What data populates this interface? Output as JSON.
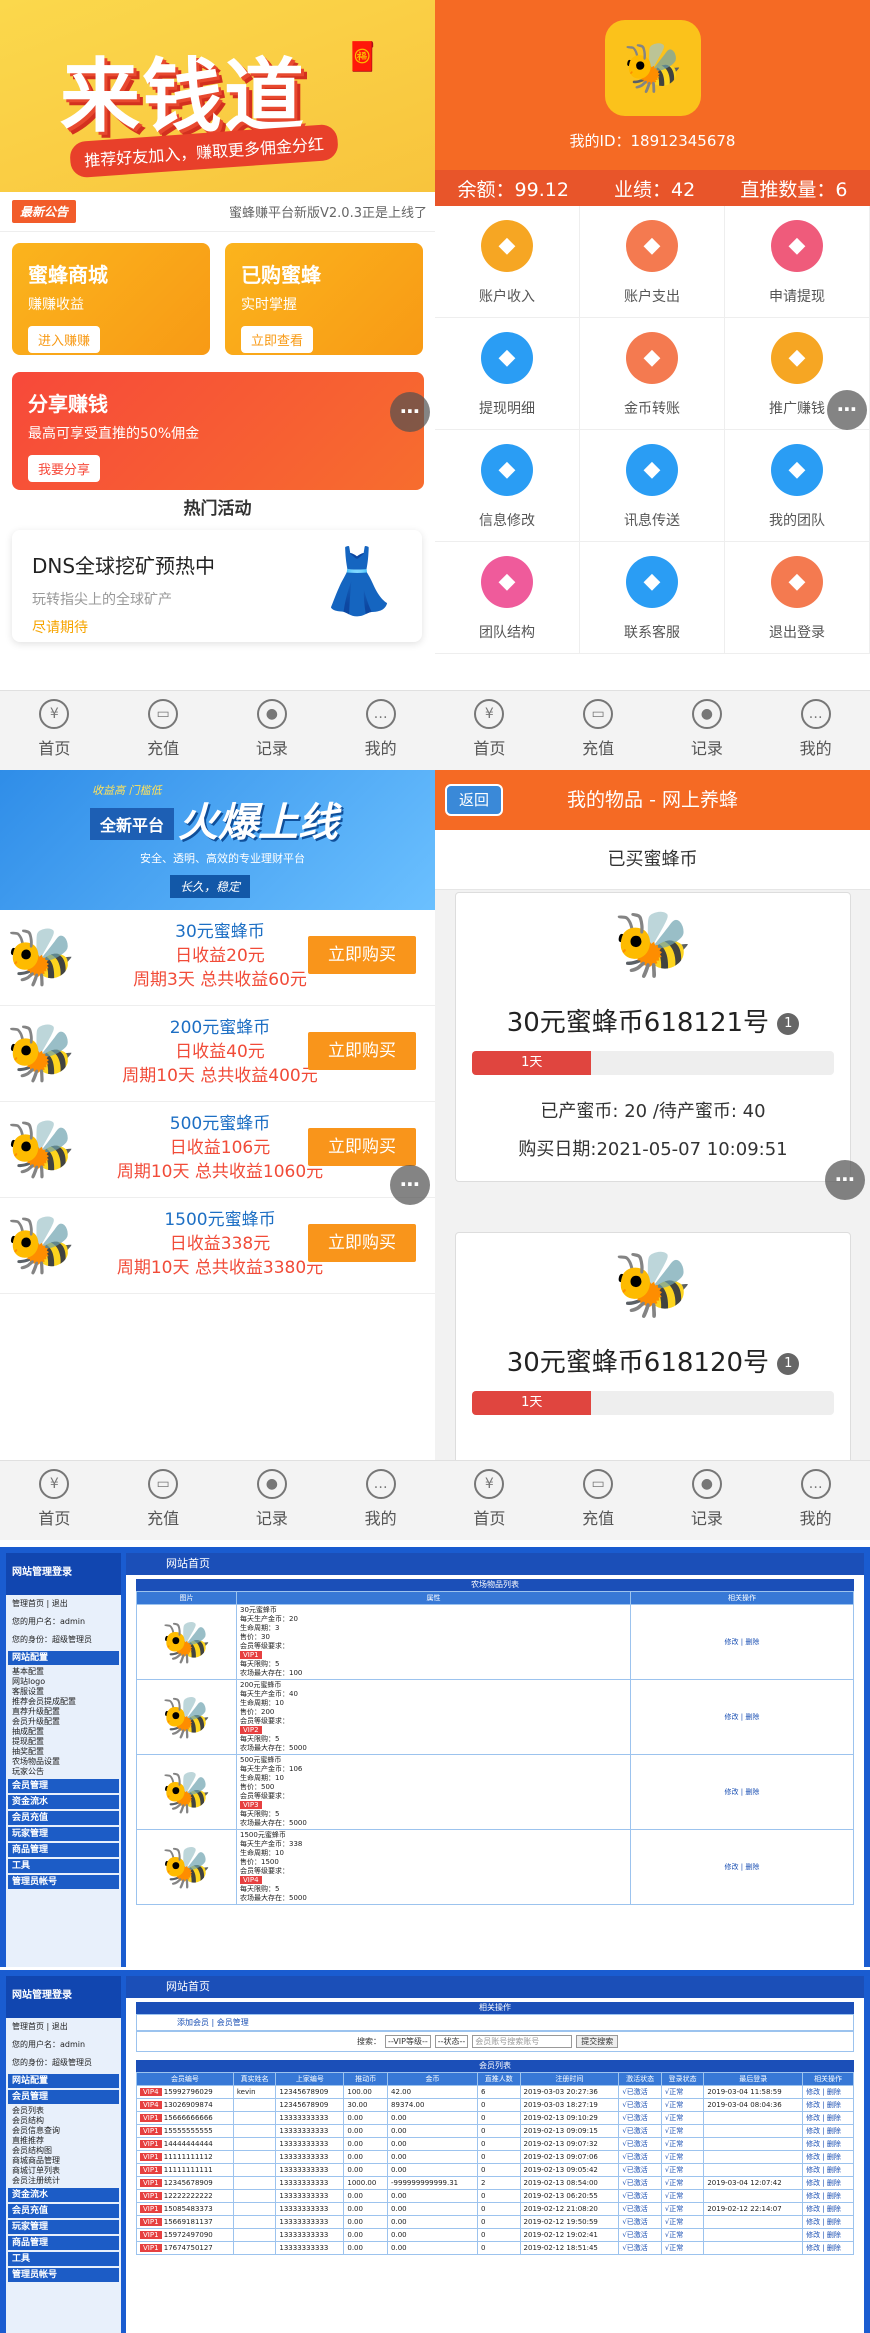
{
  "p1": {
    "title": "来钱道",
    "slogan": "推荐好友加入，赚取更多佣金分红",
    "notice_tag": "最新公告",
    "notice_text": "蜜蜂赚平台新版V2.0.3正是上线了",
    "cards": [
      {
        "title": "蜜蜂商城",
        "sub": "赚赚收益",
        "btn": "进入赚赚"
      },
      {
        "title": "已购蜜蜂",
        "sub": "实时掌握",
        "btn": "立即查看"
      },
      {
        "title": "分享赚钱",
        "sub": "最高可享受直推的50%佣金",
        "btn": "我要分享"
      }
    ],
    "hot": "热门活动",
    "dns_title": "DNS全球挖矿预热中",
    "dns_sub": "玩转指尖上的全球矿产",
    "dns_soon": "尽请期待"
  },
  "tabs": [
    {
      "label": "首页",
      "icon": "money-bag-icon"
    },
    {
      "label": "充值",
      "icon": "ticket-icon"
    },
    {
      "label": "记录",
      "icon": "location-icon"
    },
    {
      "label": "我的",
      "icon": "chat-icon"
    }
  ],
  "p2": {
    "myid": "我的ID：18912345678",
    "balance": "余额：99.12",
    "perf": "业绩：42",
    "direct": "直推数量：6",
    "grid": [
      {
        "label": "账户收入",
        "color": "#f6a623"
      },
      {
        "label": "账户支出",
        "color": "#f47a50"
      },
      {
        "label": "申请提现",
        "color": "#ef5b7b"
      },
      {
        "label": "提现明细",
        "color": "#2a9df4"
      },
      {
        "label": "金币转账",
        "color": "#f47a50"
      },
      {
        "label": "推广赚钱",
        "color": "#f6a623"
      },
      {
        "label": "信息修改",
        "color": "#2a9df4"
      },
      {
        "label": "讯息传送",
        "color": "#2a9df4"
      },
      {
        "label": "我的团队",
        "color": "#2a9df4"
      },
      {
        "label": "团队结构",
        "color": "#ef5b9b"
      },
      {
        "label": "联系客服",
        "color": "#2a9df4"
      },
      {
        "label": "退出登录",
        "color": "#f47a50"
      }
    ]
  },
  "p3": {
    "ban_tag": "全新平台",
    "ban_head": "火爆上线",
    "ban_pre": "收益高 门槛低",
    "ban_sub": "安全、透明、高效的专业理财平台",
    "ban_foot": "长久，稳定",
    "buy": "立即购买",
    "products": [
      {
        "name": "30元蜜蜂币",
        "daily": "日收益20元",
        "period": "周期3天 总共收益60元"
      },
      {
        "name": "200元蜜蜂币",
        "daily": "日收益40元",
        "period": "周期10天 总共收益400元"
      },
      {
        "name": "500元蜜蜂币",
        "daily": "日收益106元",
        "period": "周期10天 总共收益1060元"
      },
      {
        "name": "1500元蜜蜂币",
        "daily": "日收益338元",
        "period": "周期10天 总共收益3380元"
      }
    ]
  },
  "p4": {
    "back": "返回",
    "title": "我的物品 - 网上养蜂",
    "sub": "已买蜜蜂币",
    "items": [
      {
        "name": "30元蜜蜂币618121号",
        "badge": "1",
        "day": "1天",
        "progress": 0.33,
        "prod": "已产蜜币: 20 /待产蜜币: 40",
        "date": "购买日期:2021-05-07 10:09:51"
      },
      {
        "name": "30元蜜蜂币618120号",
        "badge": "1",
        "day": "1天",
        "progress": 0.33
      }
    ]
  },
  "admin": {
    "brand": "网站管理登录",
    "top_links": "管理首页 | 退出",
    "user": "您的用户名：admin",
    "role": "您的身份：超级管理员",
    "crumb": "网站首页",
    "sec1": "网站配置",
    "links1": [
      "基本配置",
      "网站logo",
      "客服设置",
      "推荐会员提成配置",
      "直荐升级配置",
      "会员升级配置",
      "抽成配置",
      "提现配置",
      "抽奖配置",
      "农场物品设置",
      "玩家公告"
    ],
    "secs": [
      "会员管理",
      "资金流水",
      "会员充值",
      "玩家管理",
      "商品管理",
      "工具",
      "管理员帐号"
    ],
    "goods_head": "农场物品列表",
    "goods_cols": [
      "图片",
      "属性",
      "相关操作"
    ],
    "goods": [
      {
        "lines": [
          "30元蜜蜂币",
          "每天生产金币：20",
          "生命周期：3",
          "售价：30",
          "会员等级要求：",
          "每天限购：5",
          "农场最大存在：100"
        ],
        "vip": "VIP1"
      },
      {
        "lines": [
          "200元蜜蜂币",
          "每天生产金币：40",
          "生命周期：10",
          "售价：200",
          "会员等级要求：",
          "每天限购：5",
          "农场最大存在：5000"
        ],
        "vip": "VIP2"
      },
      {
        "lines": [
          "500元蜜蜂币",
          "每天生产金币：106",
          "生命周期：10",
          "售价：500",
          "会员等级要求：",
          "每天限购：5",
          "农场最大存在：5000"
        ],
        "vip": "VIP3"
      },
      {
        "lines": [
          "1500元蜜蜂币",
          "每天生产金币：338",
          "生命周期：10",
          "售价：1500",
          "会员等级要求：",
          "每天限购：5",
          "农场最大存在：5000"
        ],
        "vip": "VIP4"
      }
    ],
    "op": "修改 | 删除",
    "rel": "相关操作",
    "add": "添加会员 | 会员管理",
    "search_lbl": "搜索：",
    "vip_sel": "--VIP等级--",
    "st_sel": "--状态--",
    "ph": "会员账号搜索账号",
    "sbtn": "提交搜索",
    "list_head": "会员列表",
    "sec2": "会员管理",
    "links2": [
      "会员列表",
      "会员结构",
      "会员信息查询",
      "直推推荐",
      "会员结构图",
      "商城商品管理",
      "商城订单列表",
      "会员注册统计"
    ],
    "cols": [
      "会员编号",
      "真实姓名",
      "上家编号",
      "推动币",
      "金币",
      "直推人数",
      "注册时间",
      "激活状态",
      "登录状态",
      "最后登录",
      "相关操作"
    ],
    "rows": [
      [
        "VIP4",
        "15992796029",
        "kevin",
        "12345678909",
        "100.00",
        "42.00",
        "6",
        "2019-03-03 20:27:36",
        "√已激活",
        "√正常",
        "2019-03-04 11:58:59"
      ],
      [
        "VIP4",
        "13026909874",
        "",
        "12345678909",
        "30.00",
        "89374.00",
        "0",
        "2019-03-03 18:27:19",
        "√已激活",
        "√正常",
        "2019-03-04 08:04:36"
      ],
      [
        "VIP1",
        "15666666666",
        "",
        "13333333333",
        "0.00",
        "0.00",
        "0",
        "2019-02-13 09:10:29",
        "√已激活",
        "√正常",
        ""
      ],
      [
        "VIP1",
        "15555555555",
        "",
        "13333333333",
        "0.00",
        "0.00",
        "0",
        "2019-02-13 09:09:15",
        "√已激活",
        "√正常",
        ""
      ],
      [
        "VIP1",
        "14444444444",
        "",
        "13333333333",
        "0.00",
        "0.00",
        "0",
        "2019-02-13 09:07:32",
        "√已激活",
        "√正常",
        ""
      ],
      [
        "VIP1",
        "11111111112",
        "",
        "13333333333",
        "0.00",
        "0.00",
        "0",
        "2019-02-13 09:07:06",
        "√已激活",
        "√正常",
        ""
      ],
      [
        "VIP1",
        "11111111111",
        "",
        "13333333333",
        "0.00",
        "0.00",
        "0",
        "2019-02-13 09:05:42",
        "√已激活",
        "√正常",
        ""
      ],
      [
        "VIP1",
        "12345678909",
        "",
        "13333333333",
        "1000.00",
        "-999999999999.31",
        "2",
        "2019-02-13 08:54:00",
        "√已激活",
        "√正常",
        "2019-03-04 12:07:42"
      ],
      [
        "VIP1",
        "12222222222",
        "",
        "13333333333",
        "0.00",
        "0.00",
        "0",
        "2019-02-13 06:20:55",
        "√已激活",
        "√正常",
        ""
      ],
      [
        "VIP1",
        "15085483373",
        "",
        "13333333333",
        "0.00",
        "0.00",
        "0",
        "2019-02-12 21:08:20",
        "√已激活",
        "√正常",
        "2019-02-12 22:14:07"
      ],
      [
        "VIP1",
        "15669181137",
        "",
        "13333333333",
        "0.00",
        "0.00",
        "0",
        "2019-02-12 19:50:59",
        "√已激活",
        "√正常",
        ""
      ],
      [
        "VIP1",
        "15972497090",
        "",
        "13333333333",
        "0.00",
        "0.00",
        "0",
        "2019-02-12 19:02:41",
        "√已激活",
        "√正常",
        ""
      ],
      [
        "VIP1",
        "17674750127",
        "",
        "13333333333",
        "0.00",
        "0.00",
        "0",
        "2019-02-12 18:51:45",
        "√已激活",
        "√正常",
        ""
      ]
    ]
  }
}
